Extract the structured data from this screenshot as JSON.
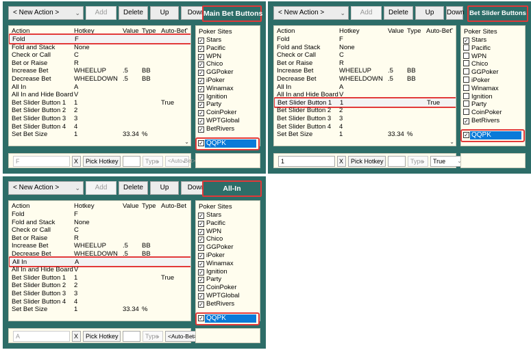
{
  "toolbar": {
    "new_action": "< New Action >",
    "add": "Add",
    "delete": "Delete",
    "up": "Up",
    "down": "Down"
  },
  "columns": {
    "action": "Action",
    "hotkey": "Hotkey",
    "value": "Value",
    "type": "Type",
    "auto_bet": "Auto-Bet"
  },
  "sites_header": "Poker Sites",
  "panels": [
    {
      "title": "Main Bet Buttons",
      "rows": [
        {
          "action": "Fold",
          "hotkey": "F",
          "value": "",
          "type": "",
          "auto": ""
        },
        {
          "action": "Fold and Stack",
          "hotkey": "None",
          "value": "",
          "type": "",
          "auto": ""
        },
        {
          "action": "Check or Call",
          "hotkey": "C",
          "value": "",
          "type": "",
          "auto": ""
        },
        {
          "action": "Bet or Raise",
          "hotkey": "R",
          "value": "",
          "type": "",
          "auto": ""
        },
        {
          "action": "Increase Bet",
          "hotkey": "WHEELUP",
          "value": ".5",
          "type": "BB",
          "auto": ""
        },
        {
          "action": "Decrease Bet",
          "hotkey": "WHEELDOWN",
          "value": ".5",
          "type": "BB",
          "auto": ""
        },
        {
          "action": "All In",
          "hotkey": "A",
          "value": "",
          "type": "",
          "auto": ""
        },
        {
          "action": "All In and Hide Board",
          "hotkey": "V",
          "value": "",
          "type": "",
          "auto": ""
        },
        {
          "action": "Bet Slider Button 1",
          "hotkey": "1",
          "value": "",
          "type": "",
          "auto": "True"
        },
        {
          "action": "Bet Slider Button 2",
          "hotkey": "2",
          "value": "",
          "type": "",
          "auto": ""
        },
        {
          "action": "Bet Slider Button 3",
          "hotkey": "3",
          "value": "",
          "type": "",
          "auto": ""
        },
        {
          "action": "Bet Slider Button 4",
          "hotkey": "4",
          "value": "",
          "type": "",
          "auto": ""
        },
        {
          "action": "Set Bet Size",
          "hotkey": "1",
          "value": "33.34",
          "type": "%",
          "auto": ""
        }
      ],
      "sites": [
        "Stars",
        "Pacific",
        "WPN",
        "Chico",
        "GGPoker",
        "iPoker",
        "Winamax",
        "Ignition",
        "Party",
        "CoinPoker",
        "WPTGlobal",
        "BetRivers"
      ],
      "sites_checked": [
        true,
        true,
        true,
        true,
        true,
        true,
        true,
        true,
        true,
        true,
        true,
        true
      ],
      "selected_site": "QQPK",
      "bottom": {
        "hotkey_value": "F",
        "x": "X",
        "pick": "Pick Hotkey",
        "type": "Type",
        "auto": "<Auto-Bet>"
      }
    },
    {
      "title": "Bet Slider Buttons",
      "rows": [
        {
          "action": "Fold",
          "hotkey": "F",
          "value": "",
          "type": "",
          "auto": ""
        },
        {
          "action": "Fold and Stack",
          "hotkey": "None",
          "value": "",
          "type": "",
          "auto": ""
        },
        {
          "action": "Check or Call",
          "hotkey": "C",
          "value": "",
          "type": "",
          "auto": ""
        },
        {
          "action": "Bet or Raise",
          "hotkey": "R",
          "value": "",
          "type": "",
          "auto": ""
        },
        {
          "action": "Increase Bet",
          "hotkey": "WHEELUP",
          "value": ".5",
          "type": "BB",
          "auto": ""
        },
        {
          "action": "Decrease Bet",
          "hotkey": "WHEELDOWN",
          "value": ".5",
          "type": "BB",
          "auto": ""
        },
        {
          "action": "All In",
          "hotkey": "A",
          "value": "",
          "type": "",
          "auto": ""
        },
        {
          "action": "All In and Hide Board",
          "hotkey": "V",
          "value": "",
          "type": "",
          "auto": ""
        },
        {
          "action": "Bet Slider Button 1",
          "hotkey": "1",
          "value": "",
          "type": "",
          "auto": "True"
        },
        {
          "action": "Bet Slider Button 2",
          "hotkey": "2",
          "value": "",
          "type": "",
          "auto": ""
        },
        {
          "action": "Bet Slider Button 3",
          "hotkey": "3",
          "value": "",
          "type": "",
          "auto": ""
        },
        {
          "action": "Bet Slider Button 4",
          "hotkey": "4",
          "value": "",
          "type": "",
          "auto": ""
        },
        {
          "action": "Set Bet Size",
          "hotkey": "1",
          "value": "33.34",
          "type": "%",
          "auto": ""
        }
      ],
      "sites": [
        "Stars",
        "Pacific",
        "WPN",
        "Chico",
        "GGPoker",
        "iPoker",
        "Winamax",
        "Ignition",
        "Party",
        "CoinPoker",
        "BetRivers"
      ],
      "sites_checked": [
        true,
        false,
        false,
        false,
        false,
        false,
        false,
        false,
        false,
        false,
        true
      ],
      "selected_site": "QQPK",
      "bottom": {
        "hotkey_value": "1",
        "x": "X",
        "pick": "Pick Hotkey",
        "type": "Type",
        "auto": "True"
      }
    },
    {
      "title": "All-In",
      "rows": [
        {
          "action": "Fold",
          "hotkey": "F",
          "value": "",
          "type": "",
          "auto": ""
        },
        {
          "action": "Fold and Stack",
          "hotkey": "None",
          "value": "",
          "type": "",
          "auto": ""
        },
        {
          "action": "Check or Call",
          "hotkey": "C",
          "value": "",
          "type": "",
          "auto": ""
        },
        {
          "action": "Bet or Raise",
          "hotkey": "R",
          "value": "",
          "type": "",
          "auto": ""
        },
        {
          "action": "Increase Bet",
          "hotkey": "WHEELUP",
          "value": ".5",
          "type": "BB",
          "auto": ""
        },
        {
          "action": "Decrease Bet",
          "hotkey": "WHEELDOWN",
          "value": ".5",
          "type": "BB",
          "auto": ""
        },
        {
          "action": "All In",
          "hotkey": "A",
          "value": "",
          "type": "",
          "auto": ""
        },
        {
          "action": "All In and Hide Board",
          "hotkey": "V",
          "value": "",
          "type": "",
          "auto": ""
        },
        {
          "action": "Bet Slider Button 1",
          "hotkey": "1",
          "value": "",
          "type": "",
          "auto": "True"
        },
        {
          "action": "Bet Slider Button 2",
          "hotkey": "2",
          "value": "",
          "type": "",
          "auto": ""
        },
        {
          "action": "Bet Slider Button 3",
          "hotkey": "3",
          "value": "",
          "type": "",
          "auto": ""
        },
        {
          "action": "Bet Slider Button 4",
          "hotkey": "4",
          "value": "",
          "type": "",
          "auto": ""
        },
        {
          "action": "Set Bet Size",
          "hotkey": "1",
          "value": "33.34",
          "type": "%",
          "auto": ""
        }
      ],
      "sites": [
        "Stars",
        "Pacific",
        "WPN",
        "Chico",
        "GGPoker",
        "iPoker",
        "Winamax",
        "Ignition",
        "Party",
        "CoinPoker",
        "WPTGlobal",
        "BetRivers"
      ],
      "sites_checked": [
        true,
        true,
        true,
        true,
        true,
        true,
        true,
        true,
        true,
        true,
        true,
        true
      ],
      "selected_site": "QQPK",
      "bottom": {
        "hotkey_value": "A",
        "x": "X",
        "pick": "Pick Hotkey",
        "type": "Type",
        "auto": "<Auto-Bet>"
      }
    }
  ]
}
